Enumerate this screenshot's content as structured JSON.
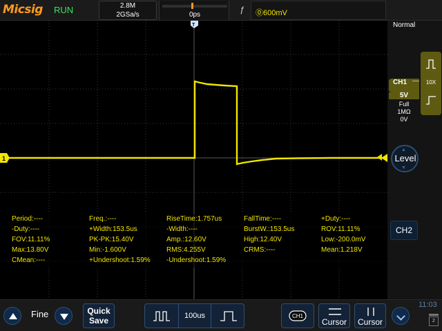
{
  "topbar": {
    "logo": "Micsig",
    "run_state": "RUN",
    "memory_depth": "2.8M",
    "sample_rate": "2GSa/s",
    "time_position": "0ps",
    "trigger_slope_icon": "rising-edge-icon",
    "trigger_level": "⓪600mV"
  },
  "right_panel": {
    "acq_mode": "Normal",
    "ch1": {
      "name": "CH1",
      "scale": "5V",
      "bandwidth": "Full",
      "impedance": "1MΩ",
      "offset": "0V",
      "probe": "10X"
    },
    "level_button": "Level",
    "ch2_button": "CH2"
  },
  "markers": {
    "ch1_marker": "1",
    "trigger_pos_marker": "T"
  },
  "measurements": [
    [
      "Period:----",
      "Freq.:----",
      "RiseTime:1.757us",
      "FallTime:----",
      "+Duty:----"
    ],
    [
      "-Duty:----",
      "+Width:153.5us",
      "-Width:----",
      "BurstW.:153.5us",
      "ROV:11.11%"
    ],
    [
      "FOV:11.11%",
      "PK-PK:15.40V",
      "Amp.:12.60V",
      "High:12.40V",
      "Low:-200.0mV"
    ],
    [
      "Max:13.80V",
      "Min:-1.600V",
      "RMS:4.255V",
      "CRMS:----",
      "Mean:1.218V"
    ],
    [
      "CMean:----",
      "+Undershoot:1.59%",
      "-Undershoot:1.59%",
      "",
      ""
    ]
  ],
  "bottombar": {
    "fine_label": "Fine",
    "quick_save_line1": "Quick",
    "quick_save_line2": "Save",
    "timebase": "100us",
    "ch1_label": "CH1",
    "cursor1_label": "Cursor",
    "cursor2_label": "Cursor",
    "clock": "11:03",
    "page_indicator": "2"
  },
  "colors": {
    "ch1_trace": "#f2e600",
    "run_green": "#3be35a",
    "logo_orange": "#ff9a1f",
    "button_blue": "#132236"
  }
}
